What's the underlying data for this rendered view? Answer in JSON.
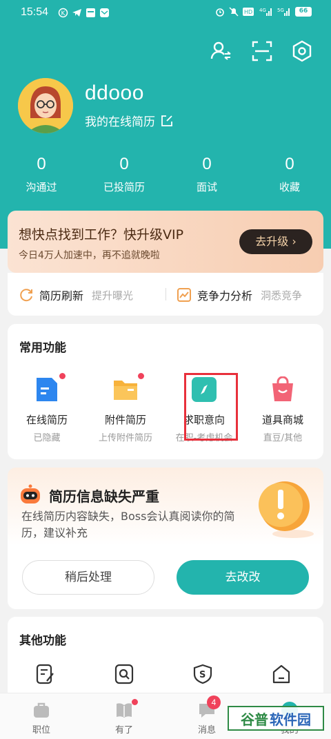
{
  "status_bar": {
    "time": "15:54",
    "battery": "66"
  },
  "profile": {
    "username": "ddooo",
    "resume_link": "我的在线简历"
  },
  "stats": [
    {
      "value": "0",
      "label": "沟通过"
    },
    {
      "value": "0",
      "label": "已投简历"
    },
    {
      "value": "0",
      "label": "面试"
    },
    {
      "value": "0",
      "label": "收藏"
    }
  ],
  "vip_banner": {
    "title": "想快点找到工作？快升级VIP",
    "subtitle": "今日4万人加速中，再不追就晚啦",
    "button": "去升级"
  },
  "quick_links": [
    {
      "label": "简历刷新",
      "sub": "提升曝光"
    },
    {
      "label": "竞争力分析",
      "sub": "洞悉竞争"
    }
  ],
  "common_functions": {
    "title": "常用功能",
    "items": [
      {
        "name": "在线简历",
        "desc": "已隐藏"
      },
      {
        "name": "附件简历",
        "desc": "上传附件简历"
      },
      {
        "name": "求职意向",
        "desc": "在职-考虑机会"
      },
      {
        "name": "道具商城",
        "desc": "直豆/其他"
      }
    ]
  },
  "resume_warning": {
    "title": "简历信息缺失严重",
    "desc": "在线简历内容缺失，Boss会认真阅读你的简历，建议补充",
    "later_button": "稍后处理",
    "fix_button": "去改改"
  },
  "other_functions": {
    "title": "其他功能"
  },
  "tab_bar": [
    {
      "label": "职位"
    },
    {
      "label": "有了"
    },
    {
      "label": "消息",
      "badge": "4"
    },
    {
      "label": "我的"
    }
  ],
  "watermark": {
    "text1": "谷普",
    "text2": "软件园"
  },
  "colors": {
    "primary": "#23b4ad",
    "badge": "#f0425b",
    "vip_btn": "#2b2320"
  }
}
